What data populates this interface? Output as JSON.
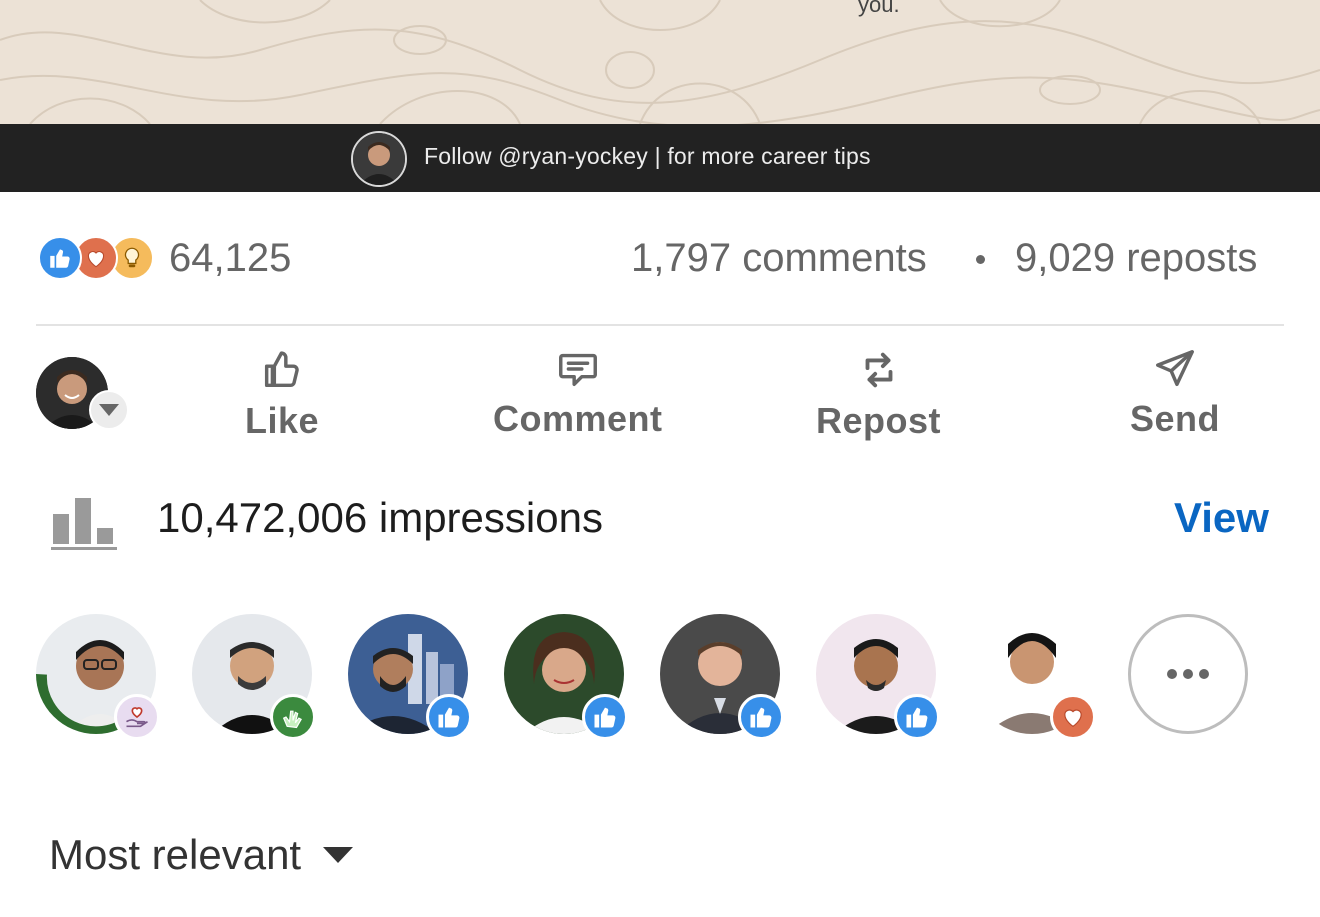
{
  "post_image": {
    "caption_fragment": "you.",
    "follow_banner": {
      "text": "Follow @ryan-yockey | for more career tips"
    }
  },
  "social_counts": {
    "reaction_icons": [
      "like-icon",
      "love-icon",
      "insightful-icon"
    ],
    "reactions_count": "64,125",
    "comments": "1,797 comments",
    "separator": "•",
    "reposts": "9,029 reposts"
  },
  "actions": {
    "like": "Like",
    "comment": "Comment",
    "repost": "Repost",
    "send": "Send"
  },
  "impressions": {
    "text": "10,472,006 impressions",
    "view_label": "View"
  },
  "reactors": [
    {
      "badge": "support-icon",
      "badge_color": "#e8dcf0",
      "ring": "#OPENTOWORK"
    },
    {
      "badge": "celebrate-icon",
      "badge_color": "#3b8a3e"
    },
    {
      "badge": "like-icon",
      "badge_color": "#378fe9"
    },
    {
      "badge": "like-icon",
      "badge_color": "#378fe9"
    },
    {
      "badge": "like-icon",
      "badge_color": "#378fe9"
    },
    {
      "badge": "like-icon",
      "badge_color": "#378fe9"
    },
    {
      "badge": "love-icon",
      "badge_color": "#df704d"
    }
  ],
  "sort": {
    "label": "Most relevant"
  },
  "colors": {
    "accent": "#0a66c2",
    "like": "#378fe9",
    "love": "#df704d",
    "insightful": "#f5bb5c",
    "banner_bg": "#222222"
  }
}
